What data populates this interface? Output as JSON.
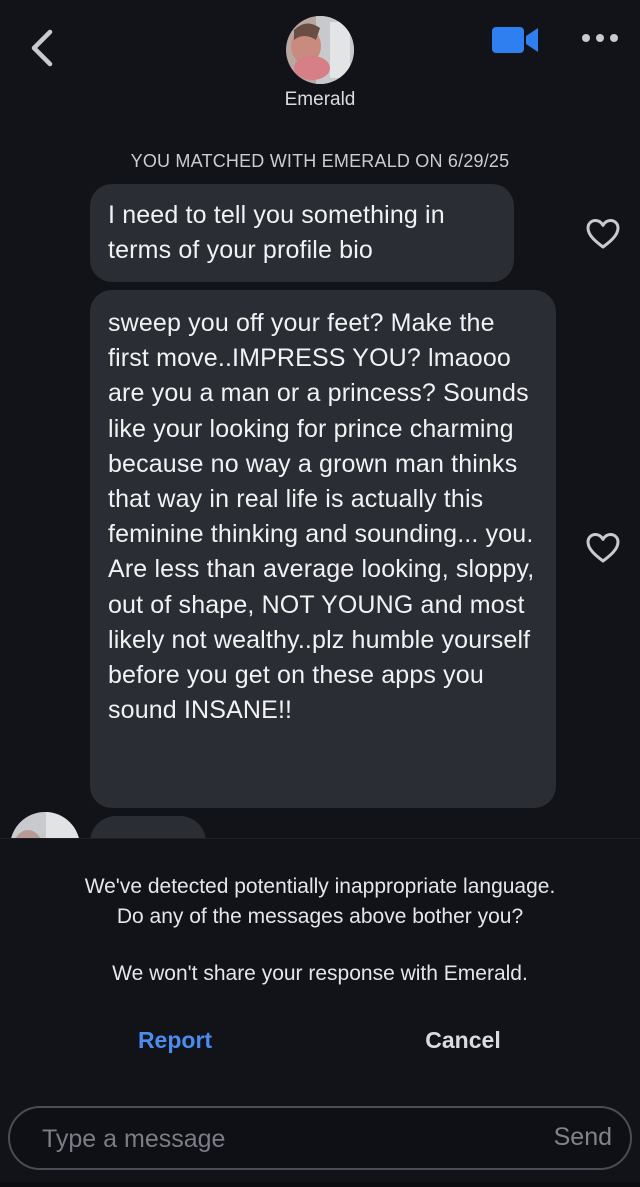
{
  "header": {
    "contact_name": "Emerald",
    "back_icon": "chevron-left-icon",
    "video_icon": "video-camera-icon",
    "more_icon": "more-horizontal-icon",
    "accent_color": "#2f7ff0"
  },
  "match_banner": "YOU MATCHED WITH EMERALD ON 6/29/25",
  "messages": [
    {
      "text": "I need to tell you something in terms of your profile bio",
      "liked": false
    },
    {
      "text": "sweep you off your feet? Make the first move..IMPRESS YOU? lmaooo are you a man or a princess?  Sounds like your looking for prince charming because no way a grown man thinks that way in real life is actually this feminine thinking and sounding... you. Are less than average looking, sloppy, out of shape, NOT YOUNG  and most likely not wealthy..plz humble yourself before you get on these apps you sound INSANE!!",
      "liked": false
    }
  ],
  "moderation": {
    "line1": "We've detected potentially inappropriate language.",
    "line2": "Do any of the messages above bother you?",
    "line3": "We won't share your response with Emerald.",
    "report_label": "Report",
    "cancel_label": "Cancel",
    "report_color": "#4a8cf0"
  },
  "composer": {
    "placeholder": "Type a message",
    "send_label": "Send"
  }
}
